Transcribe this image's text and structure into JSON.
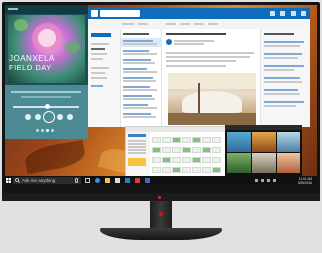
{
  "media_player": {
    "artist": "JOANXELA",
    "album": "FIELD DAY"
  },
  "taskbar": {
    "search_placeholder": "Ask me anything",
    "time": "11:01 AM",
    "date": "5/26/2016"
  },
  "colors": {
    "mail_accent": "#0f6cbd",
    "media_bg": "#1d4f58",
    "media_lower": "#4c8b93",
    "taskbar": "#101010",
    "brand_red": "#d22222"
  },
  "icons": {
    "start": "windows-logo-icon",
    "search": "search-icon",
    "mic": "microphone-icon",
    "task_view": "task-view-icon",
    "edge": "edge-browser-icon",
    "explorer": "file-explorer-icon",
    "store": "store-icon",
    "mail": "mail-icon",
    "media": "media-player-icon",
    "photos": "photos-icon"
  }
}
